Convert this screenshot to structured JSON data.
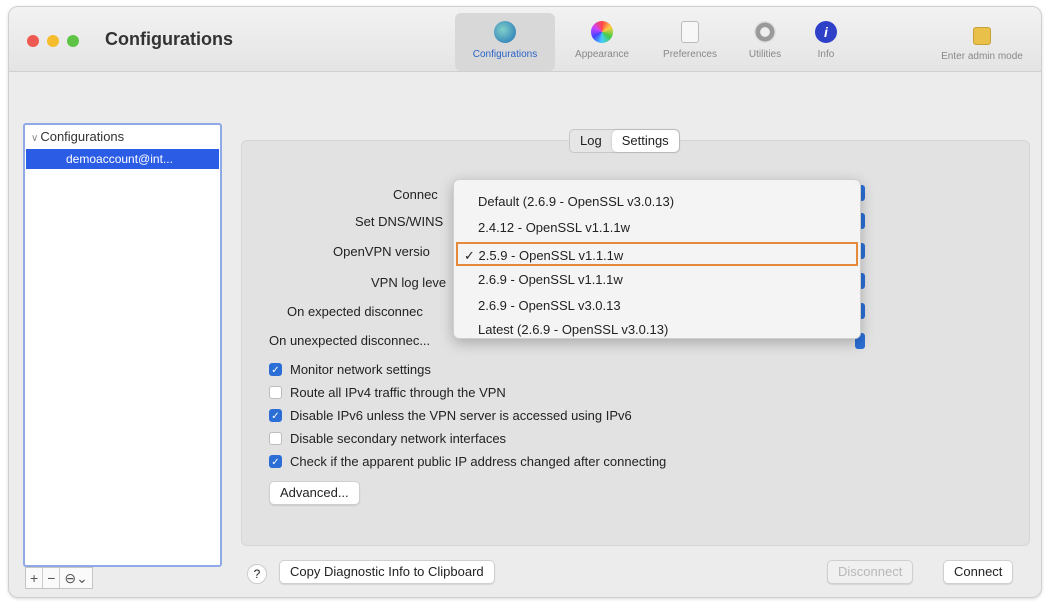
{
  "window": {
    "title": "Configurations"
  },
  "toolbar": [
    {
      "label": "Configurations",
      "icon": "configurations-icon",
      "active": true
    },
    {
      "label": "Appearance",
      "icon": "appearance-icon"
    },
    {
      "label": "Preferences",
      "icon": "preferences-icon"
    },
    {
      "label": "Utilities",
      "icon": "utilities-icon"
    },
    {
      "label": "Info",
      "icon": "info-icon"
    },
    {
      "label": "Enter admin mode",
      "icon": "lock-icon"
    }
  ],
  "sidebar": {
    "header": "Configurations",
    "selected": "demoaccount@int...",
    "buttons": [
      "+",
      "−",
      "⊖⌄"
    ]
  },
  "tabs": {
    "log": "Log",
    "settings": "Settings"
  },
  "fields": [
    {
      "label": "Connec"
    },
    {
      "label": "Set DNS/WINS"
    },
    {
      "label": "OpenVPN versio"
    },
    {
      "label": "VPN log leve"
    },
    {
      "label": "On expected disconnec"
    },
    {
      "label": "On unexpected disconnec..."
    }
  ],
  "dropdown": {
    "options": [
      "Default (2.6.9 - OpenSSL v3.0.13)",
      "2.4.12 - OpenSSL v1.1.1w",
      "✓ 2.5.9 - OpenSSL v1.1.1w",
      "2.6.9 - OpenSSL v1.1.1w",
      "2.6.9 - OpenSSL v3.0.13",
      "Latest (2.6.9 - OpenSSL v3.0.13)"
    ],
    "selected_index": 2
  },
  "checkboxes": [
    {
      "label": "Monitor network settings",
      "checked": true
    },
    {
      "label": "Route all IPv4 traffic through the VPN",
      "checked": false
    },
    {
      "label": "Disable IPv6 unless the VPN server is accessed using IPv6",
      "checked": true
    },
    {
      "label": "Disable secondary network interfaces",
      "checked": false
    },
    {
      "label": "Check if the apparent public IP address changed after connecting",
      "checked": true
    }
  ],
  "buttons": {
    "advanced": "Advanced...",
    "help": "?",
    "copy_diag": "Copy Diagnostic Info to Clipboard",
    "disconnect": "Disconnect",
    "connect": "Connect"
  },
  "colors": {
    "accent": "#2b6fd6",
    "selection_outline": "#e58a3a",
    "sidebar_selection": "#2b5ce6"
  }
}
